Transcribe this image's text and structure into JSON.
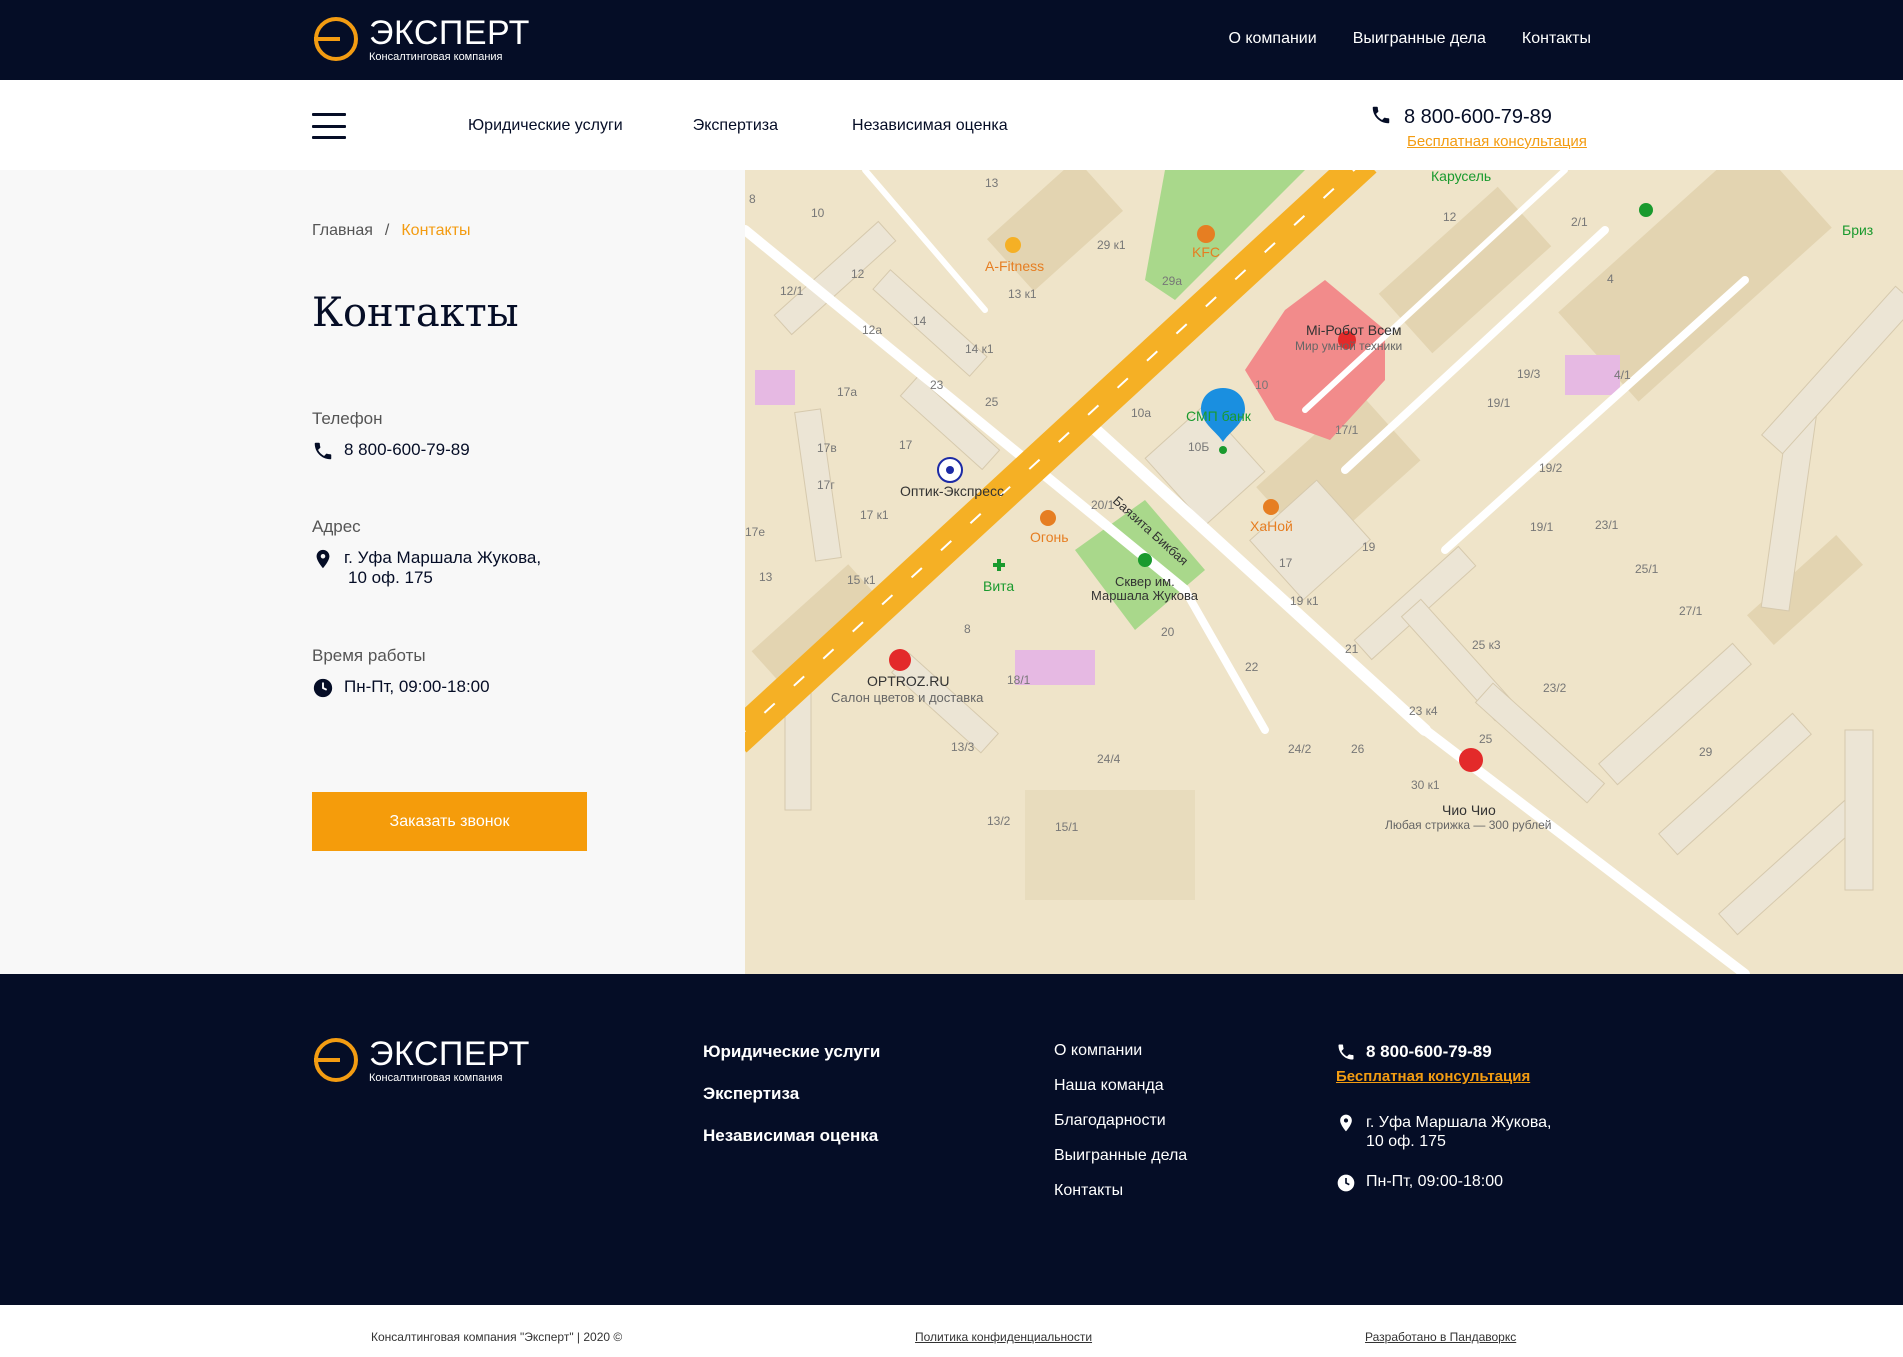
{
  "brand": {
    "title": "ЭКСПЕРТ",
    "subtitle": "Консалтинговая компания",
    "accent_color": "#f39c12",
    "dark_color": "#050d26"
  },
  "top_nav": [
    "О компании",
    "Выигранные дела",
    "Контакты"
  ],
  "main_nav": [
    "Юридические услуги",
    "Экспертиза",
    "Независимая оценка"
  ],
  "header_contact": {
    "phone": "8 800-600-79-89",
    "consult": "Бесплатная консультация"
  },
  "breadcrumb": {
    "home": "Главная",
    "separator": "/",
    "current": "Контакты"
  },
  "page_title": "Контакты",
  "contacts": {
    "phone_label": "Телефон",
    "phone": "8 800-600-79-89",
    "address_label": "Адрес",
    "address_line1": "г. Уфа Маршала Жукова,",
    "address_line2": "10 оф. 175",
    "hours_label": "Время работы",
    "hours": "Пн-Пт, 09:00-18:00"
  },
  "cta_label": "Заказать звонок",
  "map": {
    "labels": {
      "karusel": "Карусель",
      "briz": "Бриз",
      "kfc": "KFC",
      "afitness": "A-Fitness",
      "mirobot": "Mi-Робот Всем",
      "mirobot_sub": "Мир умной техники",
      "smp": "СМП банк",
      "optik": "Оптик-Экспресс",
      "ogon": "Огонь",
      "vita": "Вита",
      "hanoi": "ХаНой",
      "skver1": "Сквер им.",
      "skver2": "Маршала Жукова",
      "street": "Баязита Бикбая",
      "optroz": "OPTROZ.RU",
      "optroz_sub": "Салон цветов и доставка",
      "chio": "Чио Чио",
      "chio_sub": "Любая стрижка — 300 рублей"
    },
    "numbers": [
      "13",
      "10",
      "8",
      "12",
      "12/1",
      "14",
      "12а",
      "14 к1",
      "13 к1",
      "29 к1",
      "29а",
      "12",
      "2/1",
      "4",
      "19/3",
      "19/1",
      "17а",
      "23",
      "25",
      "17",
      "17в",
      "17г",
      "17 к1",
      "17е",
      "13",
      "15 к1",
      "10а",
      "10Б",
      "10",
      "17/1",
      "19/2",
      "19/1",
      "20/1",
      "19",
      "17",
      "19 к1",
      "20",
      "21",
      "22",
      "8",
      "18/1",
      "23/1",
      "25/1",
      "27/1",
      "25 к3",
      "23/2",
      "23 к4",
      "25",
      "24/2",
      "26",
      "30 к1",
      "29",
      "13/3",
      "13/2",
      "15/1",
      "24/4",
      "4/1"
    ]
  },
  "footer": {
    "services": [
      "Юридические услуги",
      "Экспертиза",
      "Независимая оценка"
    ],
    "company": [
      "О компании",
      "Наша команда",
      "Благодарности",
      "Выигранные дела",
      "Контакты"
    ],
    "phone": "8 800-600-79-89",
    "consult": "Бесплатная консультация",
    "address_line1": "г. Уфа Маршала Жукова,",
    "address_line2": "10 оф. 175",
    "hours": "Пн-Пт, 09:00-18:00"
  },
  "bottom": {
    "copyright": "Консалтинговая компания \"Эксперт\" | 2020 ©",
    "privacy": "Политика конфиденциальности",
    "developer": "Разработано в Пандаворкс"
  }
}
